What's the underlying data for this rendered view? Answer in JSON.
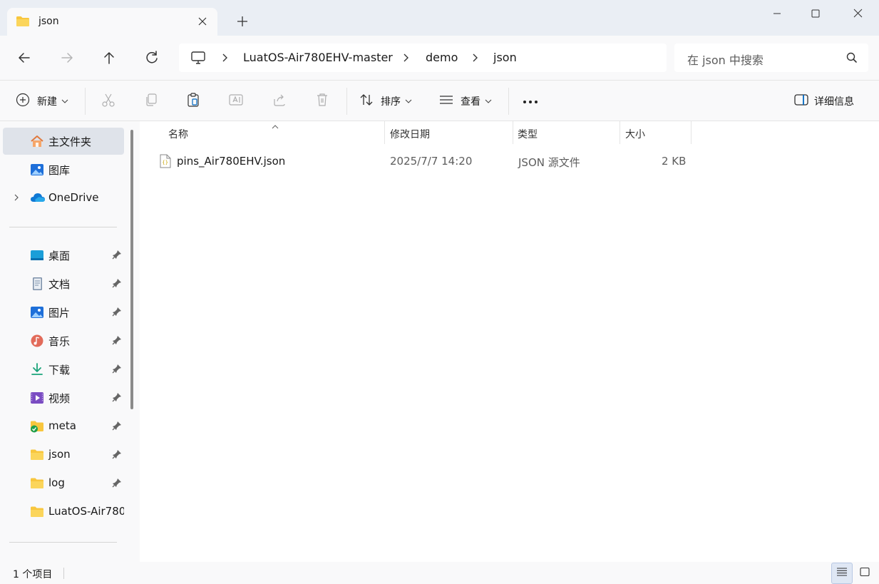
{
  "tab": {
    "title": "json",
    "close_icon": "close-icon",
    "new_tab_icon": "plus-icon"
  },
  "window": {
    "minimize_icon": "minimize-icon",
    "maximize_icon": "maximize-icon",
    "close_icon": "close-icon"
  },
  "address": {
    "root_icon": "computer-icon",
    "crumbs": [
      "LuatOS-Air780EHV-master",
      "demo",
      "json"
    ]
  },
  "search": {
    "placeholder": "在 json 中搜索"
  },
  "commands": {
    "new_label": "新建",
    "sort_label": "排序",
    "view_label": "查看",
    "more_label": "•••",
    "details_label": "详细信息"
  },
  "sidebar": {
    "items": [
      {
        "label": "主文件夹",
        "icon": "home-icon"
      },
      {
        "label": "图库",
        "icon": "gallery-icon"
      },
      {
        "label": "OneDrive",
        "icon": "onedrive-icon"
      },
      {
        "label": "桌面",
        "icon": "desktop-icon"
      },
      {
        "label": "文档",
        "icon": "documents-icon"
      },
      {
        "label": "图片",
        "icon": "pictures-icon"
      },
      {
        "label": "音乐",
        "icon": "music-icon"
      },
      {
        "label": "下载",
        "icon": "download-icon"
      },
      {
        "label": "视频",
        "icon": "videos-icon"
      },
      {
        "label": "meta",
        "icon": "folder-synced-icon"
      },
      {
        "label": "json",
        "icon": "folder-icon"
      },
      {
        "label": "log",
        "icon": "folder-icon"
      },
      {
        "label": "LuatOS-Air780",
        "icon": "folder-icon"
      }
    ]
  },
  "columns": {
    "name": "名称",
    "modified": "修改日期",
    "type": "类型",
    "size": "大小"
  },
  "files": [
    {
      "name": "pins_Air780EHV.json",
      "modified": "2025/7/7 14:20",
      "type": "JSON 源文件",
      "size": "2 KB",
      "icon": "json-file-icon"
    }
  ],
  "status": {
    "count_text": "1 个项目"
  },
  "colors": {
    "accent": "#0067c0",
    "folder": "#f8c63d",
    "selected": "#dfe3ea"
  }
}
